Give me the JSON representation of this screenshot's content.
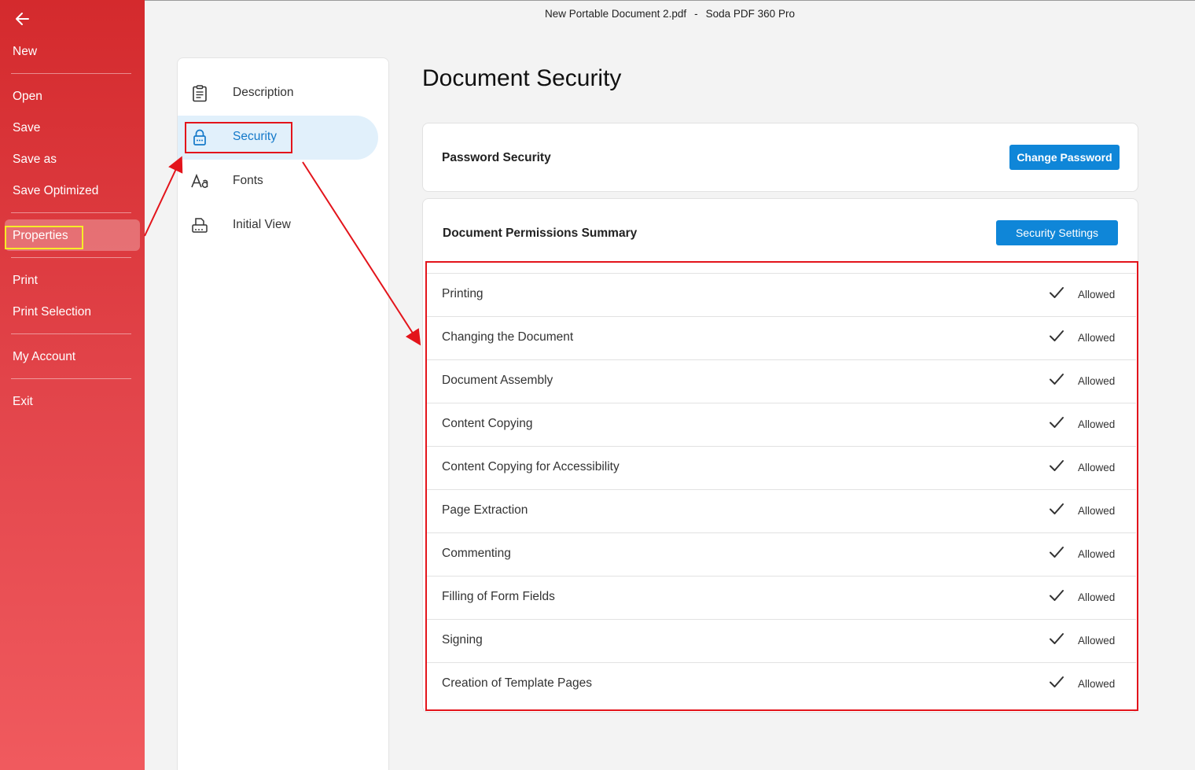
{
  "window": {
    "document_name": "New Portable Document 2.pdf",
    "separator": "-",
    "app_name": "Soda PDF 360 Pro"
  },
  "sidebar": {
    "items": [
      {
        "label": "New"
      },
      {
        "label": "Open"
      },
      {
        "label": "Save"
      },
      {
        "label": "Save as"
      },
      {
        "label": "Save Optimized"
      },
      {
        "label": "Properties"
      },
      {
        "label": "Print"
      },
      {
        "label": "Print Selection"
      },
      {
        "label": "My Account"
      },
      {
        "label": "Exit"
      }
    ]
  },
  "properties_nav": {
    "items": [
      {
        "label": "Description",
        "icon": "clipboard-icon"
      },
      {
        "label": "Security",
        "icon": "lock-icon",
        "active": true
      },
      {
        "label": "Fonts",
        "icon": "font-icon"
      },
      {
        "label": "Initial View",
        "icon": "printer-view-icon"
      }
    ]
  },
  "main": {
    "title": "Document Security",
    "password_card": {
      "title": "Password Security",
      "button_label": "Change Password"
    },
    "permissions_card": {
      "title": "Document Permissions Summary",
      "button_label": "Security Settings",
      "rows": [
        {
          "name": "Printing",
          "status": "Allowed"
        },
        {
          "name": "Changing the Document",
          "status": "Allowed"
        },
        {
          "name": "Document Assembly",
          "status": "Allowed"
        },
        {
          "name": "Content Copying",
          "status": "Allowed"
        },
        {
          "name": "Content Copying for Accessibility",
          "status": "Allowed"
        },
        {
          "name": "Page Extraction",
          "status": "Allowed"
        },
        {
          "name": "Commenting",
          "status": "Allowed"
        },
        {
          "name": "Filling of Form Fields",
          "status": "Allowed"
        },
        {
          "name": "Signing",
          "status": "Allowed"
        },
        {
          "name": "Creation of Template Pages",
          "status": "Allowed"
        }
      ]
    }
  },
  "colors": {
    "sidebar_red": "#d42a2d",
    "accent_blue": "#0f86d8",
    "annotation_red": "#e3141b",
    "annotation_yellow": "#f6ec27"
  }
}
